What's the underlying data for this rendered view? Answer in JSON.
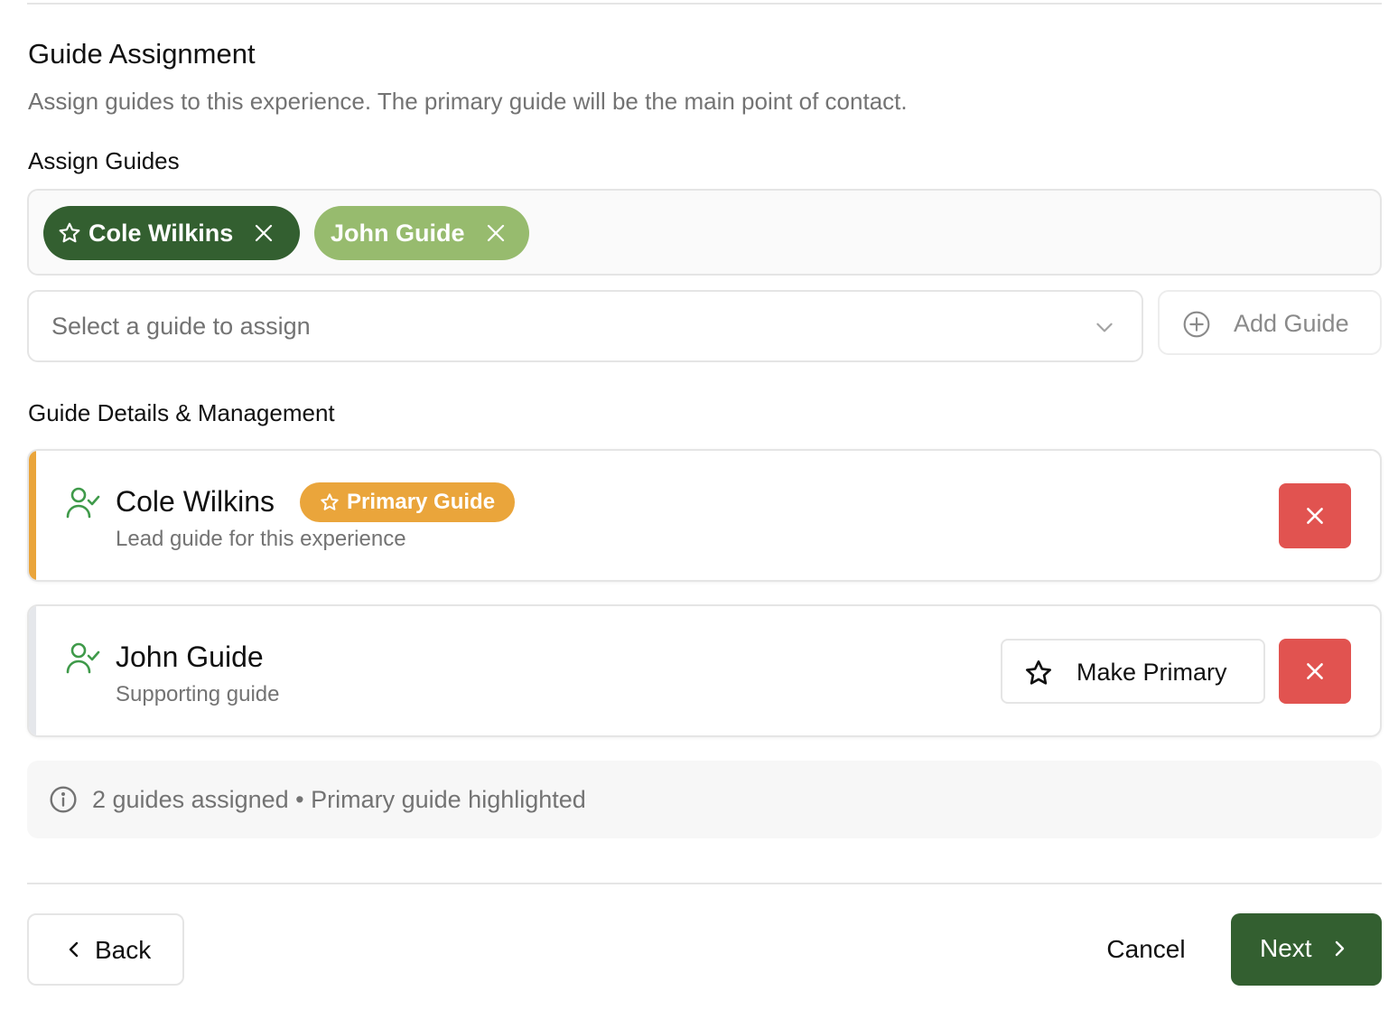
{
  "section": {
    "title": "Guide Assignment",
    "description": "Assign guides to this experience. The primary guide will be the main point of contact."
  },
  "assign": {
    "label": "Assign Guides",
    "chips": [
      {
        "name": "Cole Wilkins",
        "primary": true,
        "color": "#335f30"
      },
      {
        "name": "John Guide",
        "primary": false,
        "color": "#97bb6e"
      }
    ],
    "select_placeholder": "Select a guide to assign",
    "add_button_label": "Add Guide"
  },
  "details": {
    "label": "Guide Details & Management",
    "guides": [
      {
        "name": "Cole Wilkins",
        "subtitle": "Lead guide for this experience",
        "badge": "Primary Guide",
        "accent_color": "#eaa53b"
      },
      {
        "name": "John Guide",
        "subtitle": "Supporting guide",
        "make_primary_label": "Make Primary",
        "accent_color": "#e5e7eb"
      }
    ]
  },
  "info": {
    "text": "2 guides assigned • Primary guide highlighted"
  },
  "footer": {
    "back_label": "Back",
    "cancel_label": "Cancel",
    "next_label": "Next"
  },
  "colors": {
    "brand_dark_green": "#335f30",
    "light_green": "#97bb6e",
    "primary_badge": "#eaa53b",
    "danger": "#e15350",
    "user_icon": "#3f9a4a"
  },
  "icons": {
    "chip_primary": "star-icon",
    "chip_remove": "close-icon",
    "select": "chevron-down-icon",
    "add": "plus-circle-icon",
    "guide": "user-check-icon",
    "remove": "close-icon",
    "make_primary": "star-icon",
    "info": "info-icon",
    "back": "chevron-left-icon",
    "next": "chevron-right-icon"
  }
}
